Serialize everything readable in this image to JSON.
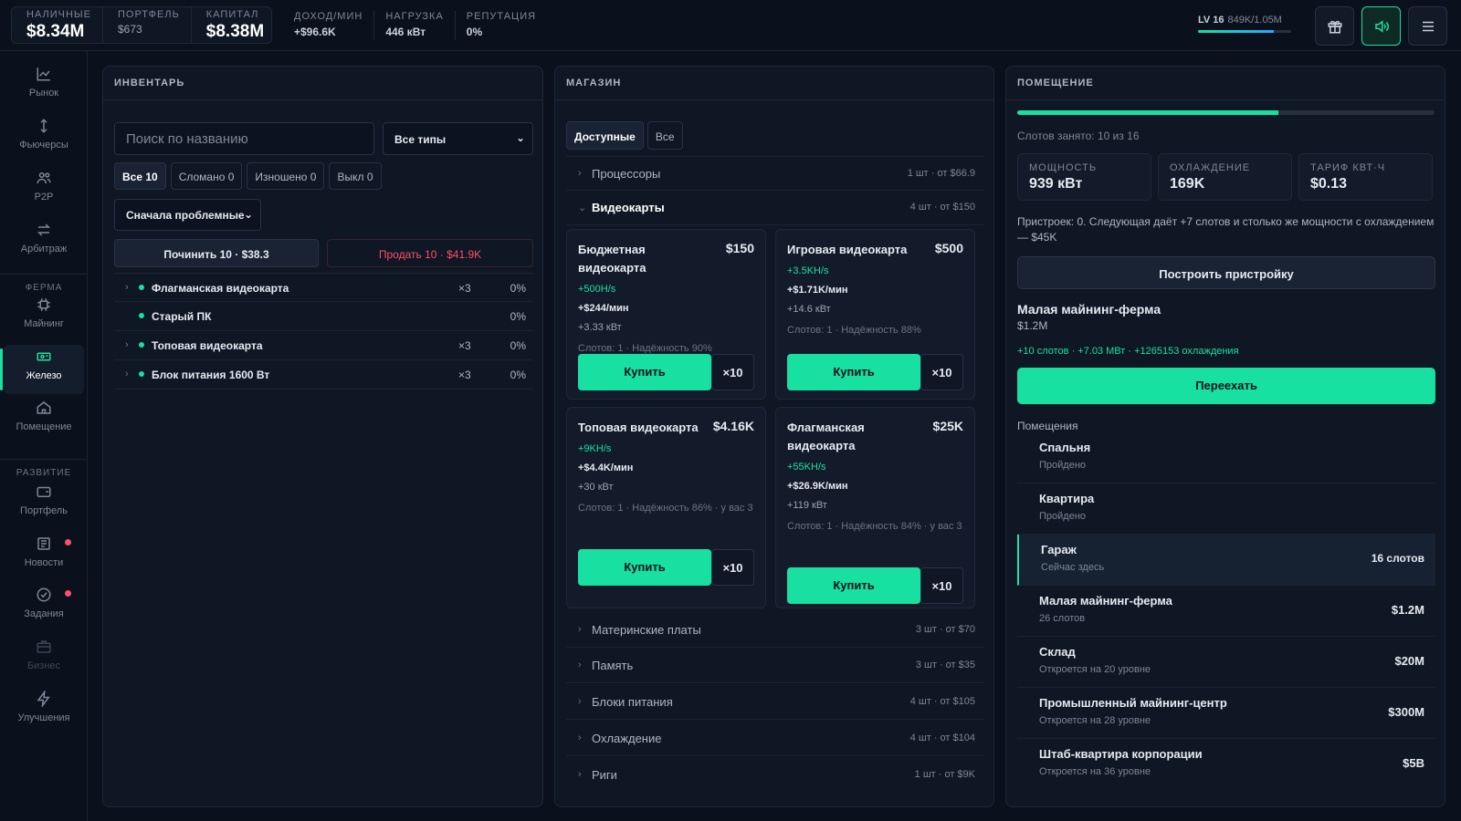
{
  "topbar": {
    "cash_label": "НАЛИЧНЫЕ",
    "cash_value": "$8.34M",
    "portfolio_label": "ПОРТФЕЛЬ",
    "portfolio_value": "$673",
    "capital_label": "КАПИТАЛ",
    "capital_value": "$8.38M",
    "income_label": "ДОХОД/МИН",
    "income_value": "+$96.6K",
    "load_label": "НАГРУЗКА",
    "load_value": "446 кВт",
    "rep_label": "РЕПУТАЦИЯ",
    "rep_value": "0%",
    "level_label": "LV 16",
    "level_xp": "849K/1.05M",
    "level_progress": 0.81,
    "icons": [
      "gift-icon",
      "sound-icon",
      "menu-icon"
    ]
  },
  "sidebar": {
    "items": [
      {
        "label": "Рынок",
        "icon": "chart-icon"
      },
      {
        "label": "Фьючерсы",
        "icon": "arrows-vertical-icon"
      },
      {
        "label": "P2P",
        "icon": "users-icon"
      },
      {
        "label": "Арбитраж",
        "icon": "swap-icon"
      }
    ],
    "farm_section": "ФЕРМА",
    "farm_items": [
      {
        "label": "Майнинг",
        "icon": "chip-icon"
      },
      {
        "label": "Железо",
        "icon": "hardware-icon"
      },
      {
        "label": "Помещение",
        "icon": "home-icon"
      }
    ],
    "dev_section": "РАЗВИТИЕ",
    "dev_items": [
      {
        "label": "Портфель",
        "icon": "wallet-icon"
      },
      {
        "label": "Новости",
        "icon": "news-icon"
      },
      {
        "label": "Задания",
        "icon": "check-circle-icon"
      },
      {
        "label": "Бизнес",
        "icon": "briefcase-icon"
      },
      {
        "label": "Улучшения",
        "icon": "bolt-icon"
      }
    ]
  },
  "inventory": {
    "title": "ИНВЕНТАРЬ",
    "search_placeholder": "Поиск по названию",
    "type_select": "Все типы",
    "filters": [
      "Все 10",
      "Сломано 0",
      "Изношено 0",
      "Выкл 0"
    ],
    "sort": "Сначала проблемные",
    "repair_label": "Починить 10 · $38.3",
    "sell_label": "Продать 10 · $41.9K",
    "items": [
      {
        "name": "Флагманская видеокарта",
        "qty": "×3",
        "wear": "0%"
      },
      {
        "name": "Старый ПК",
        "qty": "",
        "wear": "0%"
      },
      {
        "name": "Топовая видеокарта",
        "qty": "×3",
        "wear": "0%"
      },
      {
        "name": "Блок питания 1600 Вт",
        "qty": "×3",
        "wear": "0%"
      }
    ]
  },
  "shop": {
    "title": "МАГАЗИН",
    "tabs": [
      "Доступные",
      "Все"
    ],
    "categories_top": [
      {
        "name": "Процессоры",
        "info": "1 шт · от $66.9"
      },
      {
        "name": "Видеокарты",
        "info": "4 шт · от $150"
      }
    ],
    "cards": [
      {
        "title": "Бюджетная видеокарта",
        "price": "$150",
        "hash": "+500H/s",
        "income": "+$244/мин",
        "power": "+3.33 кВт",
        "meta": "Слотов: 1 · Надёжность 90%",
        "buy": "Купить",
        "x10": "×10"
      },
      {
        "title": "Игровая видеокарта",
        "price": "$500",
        "hash": "+3.5KH/s",
        "income": "+$1.71K/мин",
        "power": "+14.6 кВт",
        "meta": "Слотов: 1 · Надёжность 88%",
        "buy": "Купить",
        "x10": "×10"
      },
      {
        "title": "Топовая видеокарта",
        "price": "$4.16K",
        "hash": "+9KH/s",
        "income": "+$4.4K/мин",
        "power": "+30 кВт",
        "meta": "Слотов: 1 · Надёжность 86% · у вас 3",
        "buy": "Купить",
        "x10": "×10"
      },
      {
        "title": "Флагманская видеокарта",
        "price": "$25K",
        "hash": "+55KH/s",
        "income": "+$26.9K/мин",
        "power": "+119 кВт",
        "meta": "Слотов: 1 · Надёжность 84% · у вас 3",
        "buy": "Купить",
        "x10": "×10"
      }
    ],
    "categories_bottom": [
      {
        "name": "Материнские платы",
        "info": "3 шт · от $70"
      },
      {
        "name": "Память",
        "info": "3 шт · от $35"
      },
      {
        "name": "Блоки питания",
        "info": "4 шт · от $105"
      },
      {
        "name": "Охлаждение",
        "info": "4 шт · от $104"
      },
      {
        "name": "Риги",
        "info": "1 шт · от $9K"
      }
    ]
  },
  "room": {
    "title": "ПОМЕЩЕНИЕ",
    "slots_fill": 0.625,
    "slots_text": "Слотов занято: 10 из 16",
    "stats": [
      {
        "label": "МОЩНОСТЬ",
        "value": "939 кВт"
      },
      {
        "label": "ОХЛАЖДЕНИЕ",
        "value": "169K"
      },
      {
        "label": "ТАРИФ КВТ·Ч",
        "value": "$0.13"
      }
    ],
    "annex_text": "Пристроек: 0. Следующая даёт +7 слотов и столько же мощности с охлаждением — $45K",
    "annex_button": "Построить пристройку",
    "target_name": "Малая майнинг-ферма",
    "target_price": "$1.2M",
    "target_bonus": "+10 слотов · +7.03 МВт · +1265153 охлаждения",
    "move_button": "Переехать",
    "rooms_label": "Помещения",
    "rooms": [
      {
        "name": "Спальня",
        "sub": "Пройдено",
        "value": ""
      },
      {
        "name": "Квартира",
        "sub": "Пройдено",
        "value": ""
      },
      {
        "name": "Гараж",
        "sub": "Сейчас здесь",
        "value": "16 слотов"
      },
      {
        "name": "Малая майнинг-ферма",
        "sub": "26 слотов",
        "value": "$1.2M"
      },
      {
        "name": "Склад",
        "sub": "Откроется на 20 уровне",
        "value": "$20M"
      },
      {
        "name": "Промышленный майнинг-центр",
        "sub": "Откроется на 28 уровне",
        "value": "$300M"
      },
      {
        "name": "Штаб-квартира корпорации",
        "sub": "Откроется на 36 уровне",
        "value": "$5B"
      }
    ]
  },
  "colors": {
    "accent": "#18e0a0",
    "danger": "#ff4f6a",
    "background": "#0b111c",
    "panel": "#0f1624"
  }
}
